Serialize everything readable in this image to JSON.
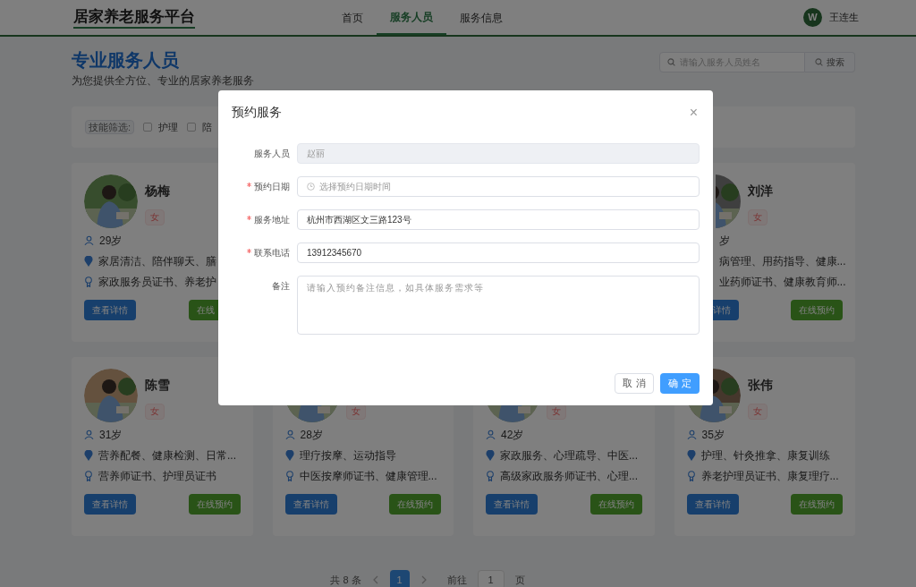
{
  "header": {
    "brand": "居家养老服务平台",
    "nav": [
      {
        "label": "首页",
        "selected": false
      },
      {
        "label": "服务人员",
        "selected": true
      },
      {
        "label": "服务信息",
        "selected": false
      }
    ],
    "user": {
      "initial": "W",
      "name": "王连生"
    }
  },
  "page": {
    "title": "专业服务人员",
    "subtitle": "为您提供全方位、专业的居家养老服务",
    "search": {
      "placeholder": "请输入服务人员姓名",
      "button": "搜索"
    }
  },
  "filter": {
    "label": "技能筛选:",
    "options": [
      {
        "label": "护理",
        "checked": false
      },
      {
        "label": "陪",
        "checked": false
      }
    ]
  },
  "card_rows": [
    [
      {
        "name": "杨梅",
        "gender": "女",
        "age": "29岁",
        "services": "家居清洁、陪伴聊天、膳",
        "certs": "家政服务员证书、养老护",
        "details": "查看详情",
        "book": "在线"
      },
      null,
      null,
      {
        "name": "刘洋",
        "gender": "女",
        "age": "岁",
        "services": "病管理、用药指导、健康...",
        "certs": "业药师证书、健康教育师...",
        "details": "详情",
        "book": "在线预约",
        "cut_left": true
      }
    ],
    [
      {
        "name": "陈雪",
        "gender": "女",
        "age": "31岁",
        "services": "营养配餐、健康检测、日常...",
        "certs": "营养师证书、护理员证书",
        "details": "查看详情",
        "book": "在线预约"
      },
      {
        "gender": "女",
        "age": "28岁",
        "services": "理疗按摩、运动指导",
        "certs": "中医按摩师证书、健康管理...",
        "details": "查看详情",
        "book": "在线预约"
      },
      {
        "gender": "女",
        "age": "42岁",
        "services": "家政服务、心理疏导、中医...",
        "certs": "高级家政服务师证书、心理...",
        "details": "查看详情",
        "book": "在线预约"
      },
      {
        "name": "张伟",
        "gender": "女",
        "age": "35岁",
        "services": "护理、针灸推拿、康复训练",
        "certs": "养老护理员证书、康复理疗...",
        "details": "查看详情",
        "book": "在线预约"
      }
    ]
  ],
  "pagination": {
    "total": "共 8 条",
    "pages": [
      {
        "label": "1",
        "selected": true
      }
    ],
    "goto": "前往",
    "goto_value": "1",
    "page_unit": "页"
  },
  "dialog": {
    "title": "预约服务",
    "close": "×",
    "fields": [
      {
        "label": "服务人员",
        "kind": "input",
        "value": "赵丽",
        "disabled": true,
        "required": false
      },
      {
        "label": "预约日期",
        "kind": "date",
        "placeholder": "选择预约日期时间",
        "disabled": false,
        "required": true
      },
      {
        "label": "服务地址",
        "kind": "input",
        "value": "杭州市西湖区文三路123号",
        "disabled": false,
        "required": true
      },
      {
        "label": "联系电话",
        "kind": "input",
        "value": "13912345670",
        "disabled": false,
        "required": true
      },
      {
        "label": "备注",
        "kind": "textarea",
        "placeholder": "请输入预约备注信息，如具体服务需求等",
        "disabled": false,
        "required": false
      }
    ],
    "cancel": "取 消",
    "confirm": "确 定"
  }
}
